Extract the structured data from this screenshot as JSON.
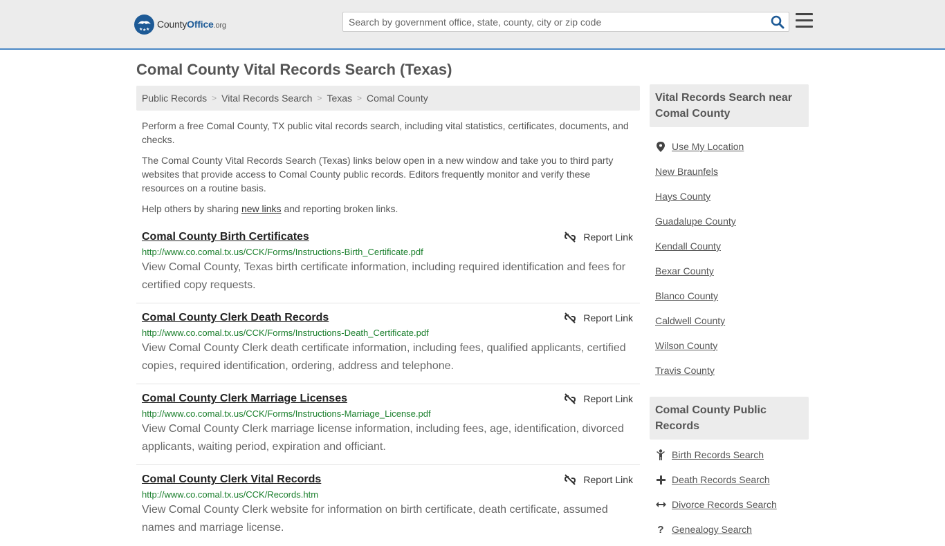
{
  "header": {
    "logo_prefix": "County",
    "logo_bold": "Office",
    "logo_suffix": ".org",
    "search_placeholder": "Search by government office, state, county, city or zip code"
  },
  "page_title": "Comal County Vital Records Search (Texas)",
  "breadcrumb": [
    "Public Records",
    "Vital Records Search",
    "Texas",
    "Comal County"
  ],
  "intro": {
    "p1": "Perform a free Comal County, TX public vital records search, including vital statistics, certificates, documents, and checks.",
    "p2": "The Comal County Vital Records Search (Texas) links below open in a new window and take you to third party websites that provide access to Comal County public records. Editors frequently monitor and verify these resources on a routine basis.",
    "p3_before": "Help others by sharing ",
    "p3_link": "new links",
    "p3_after": " and reporting broken links."
  },
  "report_label": "Report Link",
  "results": [
    {
      "title": "Comal County Birth Certificates",
      "url": "http://www.co.comal.tx.us/CCK/Forms/Instructions-Birth_Certificate.pdf",
      "desc": "View Comal County, Texas birth certificate information, including required identification and fees for certified copy requests."
    },
    {
      "title": "Comal County Clerk Death Records",
      "url": "http://www.co.comal.tx.us/CCK/Forms/Instructions-Death_Certificate.pdf",
      "desc": "View Comal County Clerk death certificate information, including fees, qualified applicants, certified copies, required identification, ordering, address and telephone."
    },
    {
      "title": "Comal County Clerk Marriage Licenses",
      "url": "http://www.co.comal.tx.us/CCK/Forms/Instructions-Marriage_License.pdf",
      "desc": "View Comal County Clerk marriage license information, including fees, age, identification, divorced applicants, waiting period, expiration and officiant."
    },
    {
      "title": "Comal County Clerk Vital Records",
      "url": "http://www.co.comal.tx.us/CCK/Records.htm",
      "desc": "View Comal County Clerk website for information on birth certificate, death certificate, assumed names and marriage license."
    }
  ],
  "sidebar": {
    "nearby_title": "Vital Records Search near Comal County",
    "use_location": "Use My Location",
    "nearby": [
      "New Braunfels",
      "Hays County",
      "Guadalupe County",
      "Kendall County",
      "Bexar County",
      "Blanco County",
      "Caldwell County",
      "Wilson County",
      "Travis County"
    ],
    "public_title": "Comal County Public Records",
    "public_records": [
      {
        "label": "Birth Records Search",
        "icon": "child-icon"
      },
      {
        "label": "Death Records Search",
        "icon": "cross-icon"
      },
      {
        "label": "Divorce Records Search",
        "icon": "arrows-icon"
      },
      {
        "label": "Genealogy Search",
        "icon": "question-icon"
      }
    ]
  }
}
